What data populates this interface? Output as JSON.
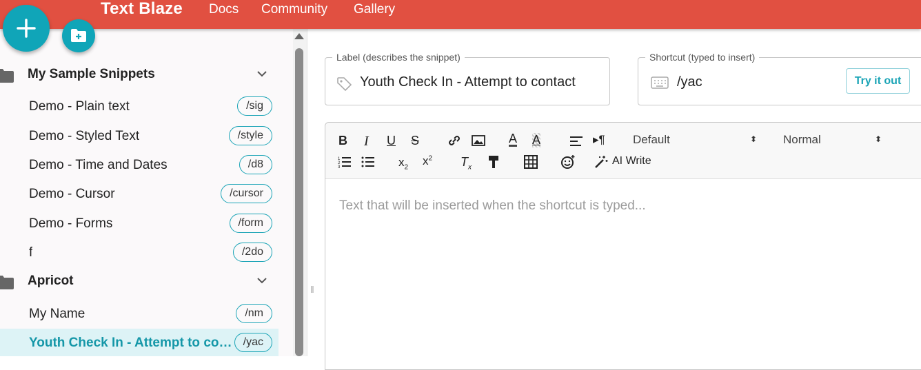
{
  "header": {
    "brand": "Text Blaze",
    "nav": [
      "Docs",
      "Community",
      "Gallery"
    ]
  },
  "fabs": {
    "new_snippet_icon": "plus-icon",
    "new_folder_icon": "folder-plus-icon"
  },
  "sidebar": {
    "folders": [
      {
        "name": "My Sample Snippets",
        "snippets": [
          {
            "label": "Demo - Plain text",
            "shortcut": "/sig"
          },
          {
            "label": "Demo - Styled Text",
            "shortcut": "/style"
          },
          {
            "label": "Demo - Time and Dates",
            "shortcut": "/d8"
          },
          {
            "label": "Demo - Cursor",
            "shortcut": "/cursor"
          },
          {
            "label": "Demo - Forms",
            "shortcut": "/form"
          },
          {
            "label": "f",
            "shortcut": "/2do"
          }
        ]
      },
      {
        "name": "Apricot",
        "snippets": [
          {
            "label": "My Name",
            "shortcut": "/nm"
          },
          {
            "label": "Youth Check In - Attempt to contact",
            "shortcut": "/yac",
            "active": true
          }
        ]
      }
    ]
  },
  "editor": {
    "label_field": {
      "legend": "Label (describes the snippet)",
      "value": "Youth Check In - Attempt to contact"
    },
    "shortcut_field": {
      "legend": "Shortcut (typed to insert)",
      "value": "/yac"
    },
    "try_it_out": "Try it out",
    "font_select": "Default",
    "size_select": "Normal",
    "ai_write": "AI Write",
    "placeholder": "Text that will be inserted when the shortcut is typed..."
  },
  "colors": {
    "brand": "#e15041",
    "accent": "#10a5b8",
    "active_bg": "#ddf3f6"
  }
}
